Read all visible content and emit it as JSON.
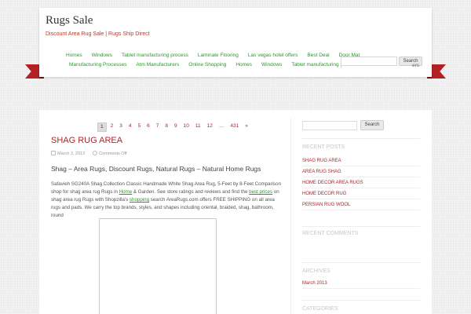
{
  "site": {
    "title": "Rugs Sale",
    "description": "Discount Area Rug Sale | Rugs Ship Direct"
  },
  "nav": {
    "row1": [
      "Homes",
      "Windows",
      "Tablet manufacturing process",
      "Laminate Flooring",
      "Las vegas hotel offers",
      "Best Deal",
      "Door Mat"
    ],
    "row2": [
      "Manufacturing Processes",
      "Atm Manufacturers",
      "Online Shopping",
      "Homes",
      "Windows",
      "Tablet manufacturing process"
    ],
    "overlap": "ers",
    "search_label": "Search"
  },
  "pager": {
    "pages": [
      "1",
      "2",
      "3",
      "4",
      "5",
      "6",
      "7",
      "8",
      "9",
      "10",
      "11",
      "12",
      "…",
      "431",
      "»"
    ],
    "current": "1"
  },
  "post": {
    "title": "SHAG RUG AREA",
    "date": "March 3, 2013",
    "comments": "Comments Off",
    "subtitle": "Shag – Area Rugs, Discount Rugs, Natural Rugs – Natural Home Rugs",
    "body_1": "Safavieh SG240A Shag Collection Classic Handmade White Shag Area Rug, 5-Feet by 8-Feet Comparison shop for shag area rug Rugs in ",
    "link_home": "Home",
    "body_2": " & Garden. See store ratings and reviews and find the ",
    "link_best_prices": "best prices",
    "body_3": " on shag area rug Rugs with Shopzilla's ",
    "link_shopping": "shopping",
    "body_4": " search AreaRugs.com offers FREE SHIPPING on all area rugs and pads. We carry the top brands, styles, and shapes including oriental, braided, shag, bathroom, round"
  },
  "sidebar": {
    "search_label": "Search",
    "recent_posts_heading": "RECENT POSTS",
    "recent_posts": [
      "SHAG RUG AREA",
      "AREA RUG SHAG",
      "HOME DECOR AREA RUGS",
      "HOME DECOR RUG",
      "PERSIAN RUG WOOL"
    ],
    "recent_comments_heading": "RECENT COMMENTS",
    "archives_heading": "ARCHIVES",
    "archives": [
      "March 2013"
    ],
    "categories_heading": "CATEGORIES"
  },
  "colors": {
    "accent": "#b32125",
    "link": "#2a9a2a"
  }
}
